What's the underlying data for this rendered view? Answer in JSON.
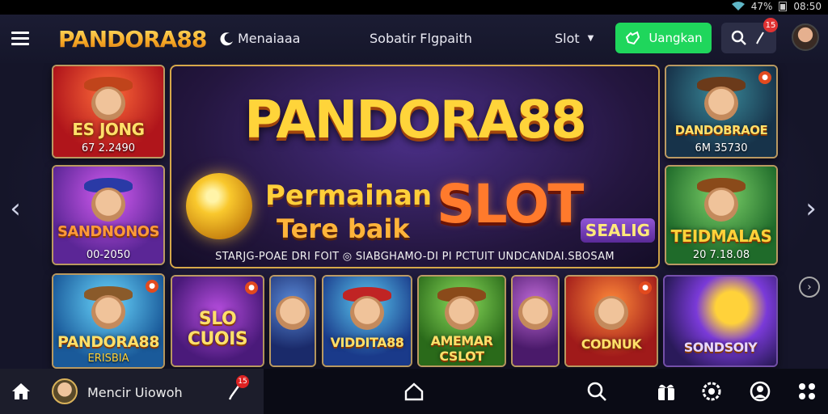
{
  "status_bar": {
    "battery": "47%",
    "time": "08:50"
  },
  "header": {
    "brand": "PANDORA88",
    "nav": [
      {
        "label": "Menaiaaa",
        "icon": "crescent-icon"
      },
      {
        "label": "Sobatir Flgpaith"
      },
      {
        "label": "Slot",
        "icon": "chevron-down-icon"
      }
    ],
    "login_label": "Uangkan",
    "notif_count": "15"
  },
  "hero": {
    "title": "PANDORA88",
    "line1": "Permainan",
    "line2": "Tere baik",
    "slot_word": "SLOT",
    "badge": "SEALIG",
    "caption": "STARJG-POAE DRI FOIT ◎ SIABGHAMO-DI PI PCTUIT UNDCANDAI.SBOSAM"
  },
  "left_cards": [
    {
      "title": "ES JONG",
      "sub": "67 2.2490"
    },
    {
      "title": "SANDNONOS",
      "sub": "00-2050"
    }
  ],
  "right_cards": [
    {
      "title": "DANDOBRAOE",
      "sub": "6M 35730"
    },
    {
      "title": "TEIDMALAS",
      "sub": "20 7.18.08"
    }
  ],
  "bottom_row": [
    {
      "title": "PANDORA88",
      "sub": "ERISBIA"
    },
    {
      "title": "SLO CUOIS"
    },
    {
      "title": ""
    },
    {
      "title": "VIDDITA88"
    },
    {
      "title": "AMEMAR CSLOT"
    },
    {
      "title": ""
    },
    {
      "title": "CODNUK"
    },
    {
      "title": "SONDSOIY"
    }
  ],
  "bottom_bar": {
    "username": "Mencir Uiowoh",
    "pin_count": "15"
  },
  "colors": {
    "accent_green": "#1fd65c",
    "brand_gold": "#f5a623",
    "bg": "#15162a"
  }
}
